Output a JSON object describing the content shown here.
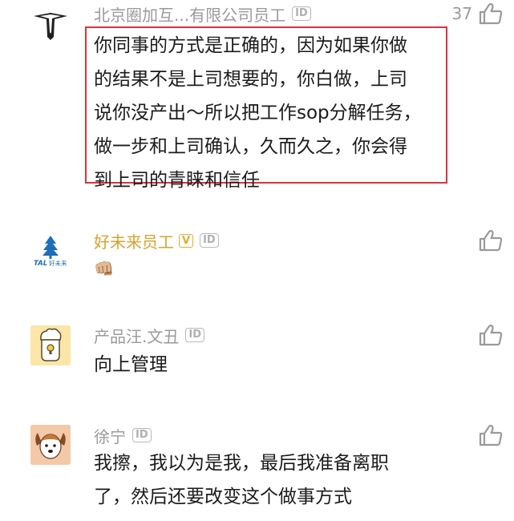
{
  "comments": [
    {
      "author": "北京圈加互...有限公司员工",
      "badge": "ID",
      "likes": "37",
      "text_lines": [
        "你同事的方式是正确的，因为如果你做",
        "的结果不是上司想要的，你白做，上司",
        "说你没产出～所以把工作sop分解任务，",
        "做一步和上司确认，久而久之，你会得",
        "到上司的青睐和信任"
      ],
      "avatar_icon": "triangle-logo-icon"
    },
    {
      "author": "好未来员工",
      "verified_badge": "V",
      "badge": "ID",
      "likes": "",
      "text": "👊🏼",
      "avatar_logo_text": "TAL好未来",
      "avatar_icon": "tal-logo-icon"
    },
    {
      "author": "产品汪.文丑",
      "badge": "ID",
      "likes": "",
      "text": "向上管理",
      "avatar_icon": "cartoon-person-avatar-icon"
    },
    {
      "author": "徐宁",
      "badge": "ID",
      "likes": "",
      "text_lines": [
        "我擦，我以为是我，最后我准备离职",
        "了，然后还要改变这个做事方式"
      ],
      "avatar_icon": "dog-avatar-icon"
    }
  ],
  "colors": {
    "highlight_border": "#e0323a",
    "name_gray": "#9a9a9a",
    "name_gold": "#d9a12e",
    "text": "#1b1b1b"
  }
}
